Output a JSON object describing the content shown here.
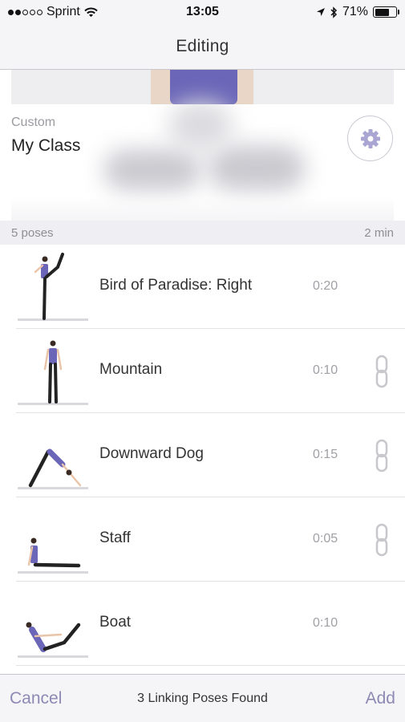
{
  "status_bar": {
    "carrier": "Sprint",
    "time": "13:05",
    "battery": "71%",
    "battery_level": 0.71
  },
  "nav": {
    "title": "Editing"
  },
  "class_info": {
    "type": "Custom",
    "name": "My Class",
    "settings_icon": "gear-icon"
  },
  "summary": {
    "pose_count": "5 poses",
    "total_duration": "2 min"
  },
  "poses": [
    {
      "name": "Bird of Paradise: Right",
      "duration": "0:20",
      "linked": false
    },
    {
      "name": "Mountain",
      "duration": "0:10",
      "linked": true
    },
    {
      "name": "Downward Dog",
      "duration": "0:15",
      "linked": true
    },
    {
      "name": "Staff",
      "duration": "0:05",
      "linked": true
    },
    {
      "name": "Boat",
      "duration": "0:10",
      "linked": false
    }
  ],
  "toolbar": {
    "cancel_label": "Cancel",
    "status": "3 Linking Poses Found",
    "add_label": "Add"
  },
  "colors": {
    "accent": "#8d89b5",
    "outfit": "#6b66b8",
    "gear": "#a9a6d3"
  }
}
